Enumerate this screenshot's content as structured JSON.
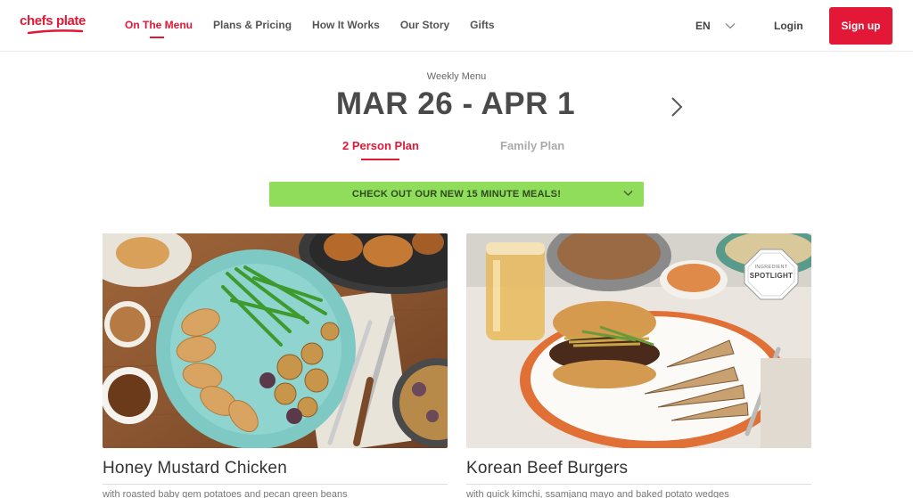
{
  "header": {
    "logo_text": "chefs plate",
    "nav": [
      {
        "label": "On The Menu",
        "active": true
      },
      {
        "label": "Plans & Pricing",
        "active": false
      },
      {
        "label": "How It Works",
        "active": false
      },
      {
        "label": "Our Story",
        "active": false
      },
      {
        "label": "Gifts",
        "active": false
      }
    ],
    "language": "EN",
    "login_label": "Login",
    "signup_label": "Sign up"
  },
  "menu": {
    "weekly_label": "Weekly Menu",
    "week_range": "MAR 26 - APR 1",
    "plans": [
      "2 Person Plan",
      "Family Plan"
    ],
    "active_plan": "2 Person Plan",
    "promo_text": "CHECK OUT OUR NEW 15 MINUTE MEALS!"
  },
  "recipes": [
    {
      "title": "Honey Mustard Chicken",
      "subtitle": "with roasted baby gem potatoes and pecan green beans"
    },
    {
      "title": "Korean Beef Burgers",
      "subtitle": "with quick kimchi, ssamjang mayo and baked potato wedges",
      "badge_small": "INGREDIENT",
      "badge_big": "SPOTLIGHT"
    }
  ],
  "colors": {
    "brand_red": "#e31837",
    "promo_green": "#8fdd5a",
    "text_dark": "#4a4a4a"
  }
}
